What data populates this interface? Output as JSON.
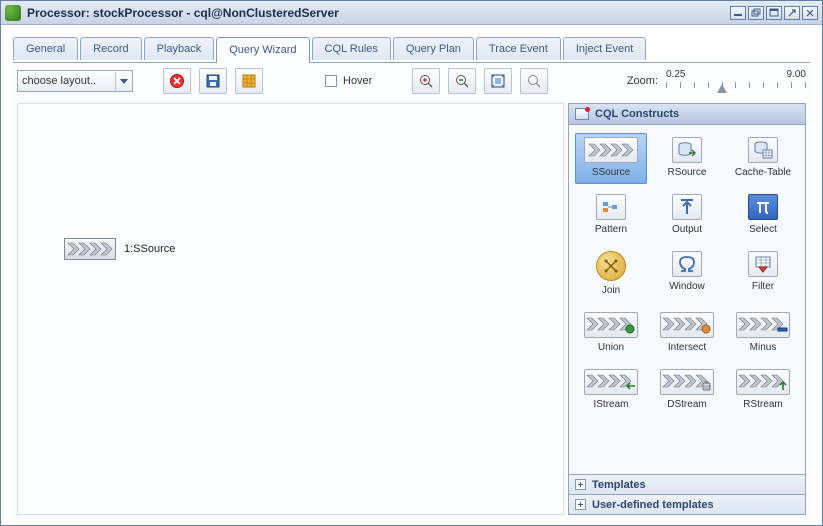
{
  "window": {
    "title": "Processor: stockProcessor - cql@NonClusteredServer"
  },
  "tabs": [
    {
      "id": "general",
      "label": "General"
    },
    {
      "id": "record",
      "label": "Record"
    },
    {
      "id": "playback",
      "label": "Playback"
    },
    {
      "id": "query-wizard",
      "label": "Query Wizard",
      "active": true
    },
    {
      "id": "cql-rules",
      "label": "CQL Rules"
    },
    {
      "id": "query-plan",
      "label": "Query Plan"
    },
    {
      "id": "trace-event",
      "label": "Trace Event"
    },
    {
      "id": "inject-event",
      "label": "Inject Event"
    }
  ],
  "toolbar": {
    "layout_dropdown": "choose layout..",
    "hover_label": "Hover",
    "zoom_label": "Zoom:",
    "zoom_min": "0.25",
    "zoom_max": "9.00"
  },
  "canvas": {
    "node_label": "1:SSource"
  },
  "palette": {
    "header": "CQL Constructs",
    "items": [
      {
        "key": "ssource",
        "label": "SSource",
        "icon": "chev",
        "selected": true
      },
      {
        "key": "rsource",
        "label": "RSource",
        "icon": "db-arrow"
      },
      {
        "key": "cache-table",
        "label": "Cache-Table",
        "icon": "db-grid"
      },
      {
        "key": "pattern",
        "label": "Pattern",
        "icon": "pattern"
      },
      {
        "key": "output",
        "label": "Output",
        "icon": "output"
      },
      {
        "key": "select",
        "label": "Select",
        "icon": "pi"
      },
      {
        "key": "join",
        "label": "Join",
        "icon": "join"
      },
      {
        "key": "window",
        "label": "Window",
        "icon": "omega"
      },
      {
        "key": "filter",
        "label": "Filter",
        "icon": "filter"
      },
      {
        "key": "union",
        "label": "Union",
        "icon": "chev-ball-g"
      },
      {
        "key": "intersect",
        "label": "Intersect",
        "icon": "chev-ball-o"
      },
      {
        "key": "minus",
        "label": "Minus",
        "icon": "chev-minus"
      },
      {
        "key": "istream",
        "label": "IStream",
        "icon": "chev-in"
      },
      {
        "key": "dstream",
        "label": "DStream",
        "icon": "chev-trash"
      },
      {
        "key": "rstream",
        "label": "RStream",
        "icon": "chev-up"
      }
    ],
    "sections": [
      {
        "label": "Templates"
      },
      {
        "label": "User-defined templates"
      }
    ]
  }
}
